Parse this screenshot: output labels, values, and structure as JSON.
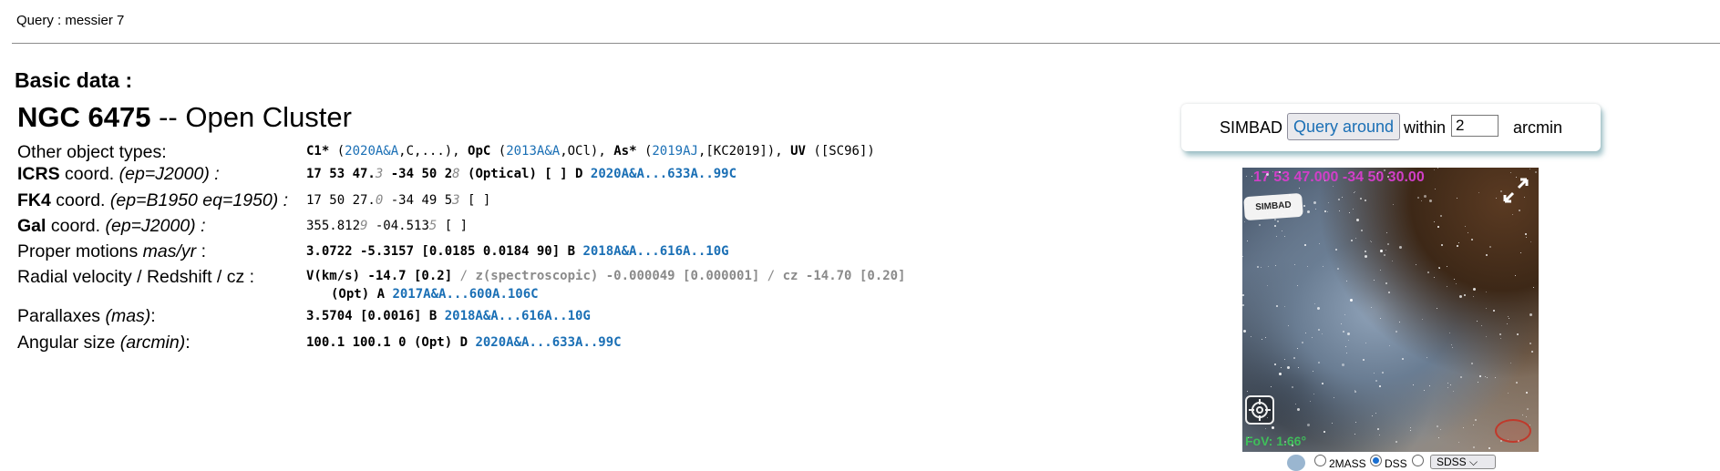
{
  "query": {
    "text": "Query : messier 7"
  },
  "section": {
    "title": "Basic data :"
  },
  "object": {
    "name": "NGC 6475",
    "sep": " -- ",
    "type": "Open Cluster"
  },
  "rows": {
    "other": {
      "label": "Other object types:",
      "parts": [
        {
          "t": "C1*",
          "s": "bold"
        },
        {
          "t": " ("
        },
        {
          "t": "2020A&A",
          "s": "lnk"
        },
        {
          "t": ",C,...), "
        },
        {
          "t": "OpC",
          "s": "bold"
        },
        {
          "t": " ("
        },
        {
          "t": "2013A&A",
          "s": "lnk"
        },
        {
          "t": ",OCl), "
        },
        {
          "t": "As*",
          "s": "bold"
        },
        {
          "t": " ("
        },
        {
          "t": "2019AJ",
          "s": "lnk"
        },
        {
          "t": ",[KC2019]), "
        },
        {
          "t": "UV",
          "s": "bold"
        },
        {
          "t": " ([SC96])"
        }
      ]
    },
    "icrs": {
      "label_b": "ICRS",
      "label_n": " coord. ",
      "label_i": "(ep=J2000) :",
      "parts": [
        {
          "t": "17 53 47.",
          "s": "bold"
        },
        {
          "t": "3",
          "s": "ital-g"
        },
        {
          "t": " -34 50 2",
          "s": "bold"
        },
        {
          "t": "8",
          "s": "ital-g"
        },
        {
          "t": " (Optical) [ ] D ",
          "s": "bold"
        },
        {
          "t": "2020A&A...633A..99C",
          "s": "lnk bold"
        }
      ]
    },
    "fk4": {
      "label_b": "FK4",
      "label_n": " coord. ",
      "label_i": "(ep=B1950 eq=1950) :",
      "parts": [
        {
          "t": "17 50 27."
        },
        {
          "t": "0",
          "s": "ital-g"
        },
        {
          "t": " -34 49 5"
        },
        {
          "t": "3",
          "s": "ital-g"
        },
        {
          "t": " [ ]"
        }
      ]
    },
    "gal": {
      "label_b": "Gal",
      "label_n": " coord. ",
      "label_i": "(ep=J2000) :",
      "parts": [
        {
          "t": "355.812"
        },
        {
          "t": "9",
          "s": "ital-g"
        },
        {
          "t": " -04.513"
        },
        {
          "t": "5",
          "s": "ital-g"
        },
        {
          "t": " [ ]"
        }
      ]
    },
    "pm": {
      "label_n": "Proper motions ",
      "label_i": "mas/yr",
      "label_end": " :",
      "parts": [
        {
          "t": "3.0722 -5.3157 [0.0185 0.0184 90] B ",
          "s": "bold"
        },
        {
          "t": "2018A&A...616A..10G",
          "s": "lnk bold"
        }
      ]
    },
    "rv": {
      "label": "Radial velocity / Redshift / cz :",
      "parts": [
        {
          "t": "V(km/s) -14.7 [0.2]",
          "s": "bold"
        },
        {
          "t": " / ",
          "s": "gray"
        },
        {
          "t": "z(spectroscopic) -0.000049 [0.000001]",
          "s": "gray bold"
        },
        {
          "t": " / ",
          "s": "gray"
        },
        {
          "t": "cz -14.70 [0.20]",
          "s": "gray bold"
        }
      ],
      "parts2": [
        {
          "t": "(Opt) A ",
          "s": "bold"
        },
        {
          "t": "2017A&A...600A.106C",
          "s": "lnk bold"
        }
      ]
    },
    "plx": {
      "label_n": "Parallaxes ",
      "label_i": "(mas)",
      "label_end": ":",
      "parts": [
        {
          "t": "3.5704 [0.0016] B ",
          "s": "bold"
        },
        {
          "t": "2018A&A...616A..10G",
          "s": "lnk bold"
        }
      ]
    },
    "ang": {
      "label_n": "Angular size ",
      "label_i": "(arcmin)",
      "label_end": ":",
      "parts": [
        {
          "t": "100.1 100.1 0 (Opt) D ",
          "s": "bold"
        },
        {
          "t": "2020A&A...633A..99C",
          "s": "lnk bold"
        }
      ]
    }
  },
  "simbad_box": {
    "label": "SIMBAD",
    "button": "Query around",
    "within": "within",
    "radius": "2",
    "unit": "arcmin"
  },
  "viewer": {
    "coord": "17 53 47.000 -34 50 30.00",
    "logo": "SIMBAD",
    "fov": "FoV: 1.66°",
    "surveys": [
      "2MASS",
      "DSS",
      "SDSS"
    ],
    "selected_survey": "DSS",
    "select_value": "SDSS"
  },
  "colors": {
    "link": "#1a6fb5",
    "coord_overlay": "#d13fc8",
    "fov": "#3fbf5a"
  }
}
